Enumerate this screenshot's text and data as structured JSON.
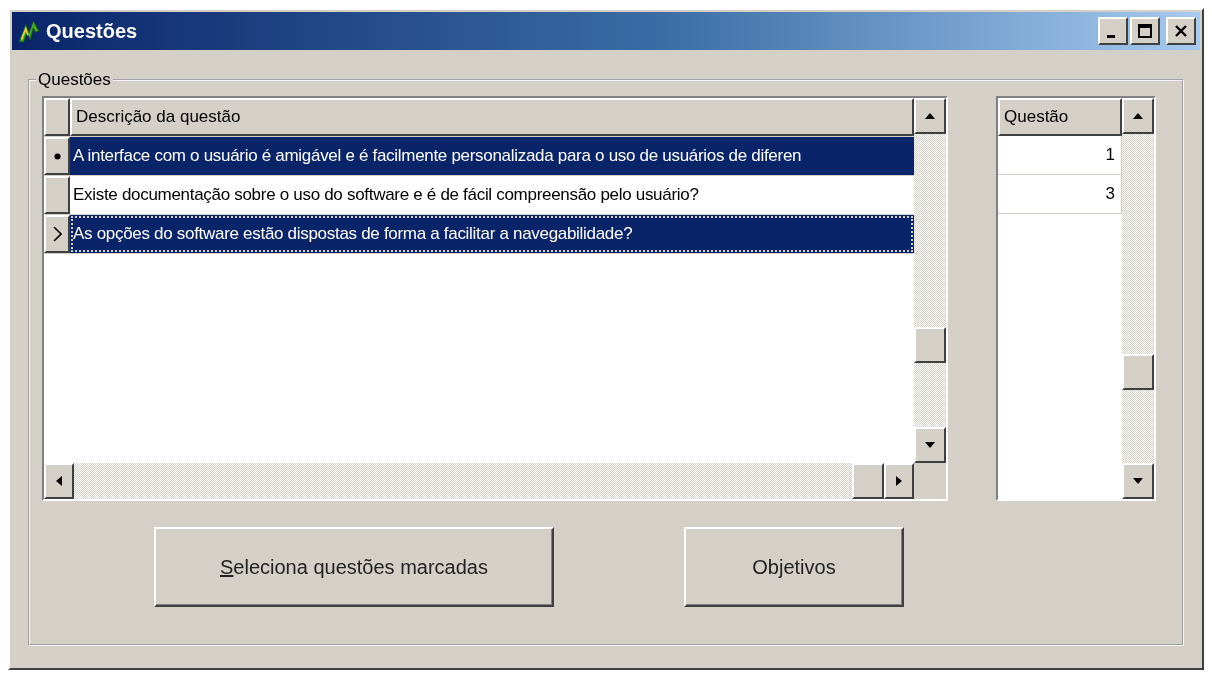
{
  "window": {
    "title": "Questões"
  },
  "group": {
    "label": "Questões"
  },
  "questions_grid": {
    "columns": [
      "Descrição da questão"
    ],
    "rows": [
      {
        "text": "A interface com o usuário é amigável e é facilmente personalizada para o uso de usuários de diferen",
        "selected": true,
        "marked": true,
        "current": false,
        "focused": false
      },
      {
        "text": "Existe documentação sobre o uso do software e é de fácil compreensão pelo usuário?",
        "selected": false,
        "marked": false,
        "current": false,
        "focused": false
      },
      {
        "text": "As opções do software estão dispostas de forma a facilitar a navegabilidade?",
        "selected": true,
        "marked": false,
        "current": true,
        "focused": true
      }
    ]
  },
  "numbers_grid": {
    "columns": [
      "Questão"
    ],
    "rows": [
      {
        "text": "1"
      },
      {
        "text": "3"
      }
    ]
  },
  "buttons": [
    {
      "label": "Seleciona questões marcadas",
      "underline_first": true
    },
    {
      "label": "Objetivos"
    }
  ]
}
